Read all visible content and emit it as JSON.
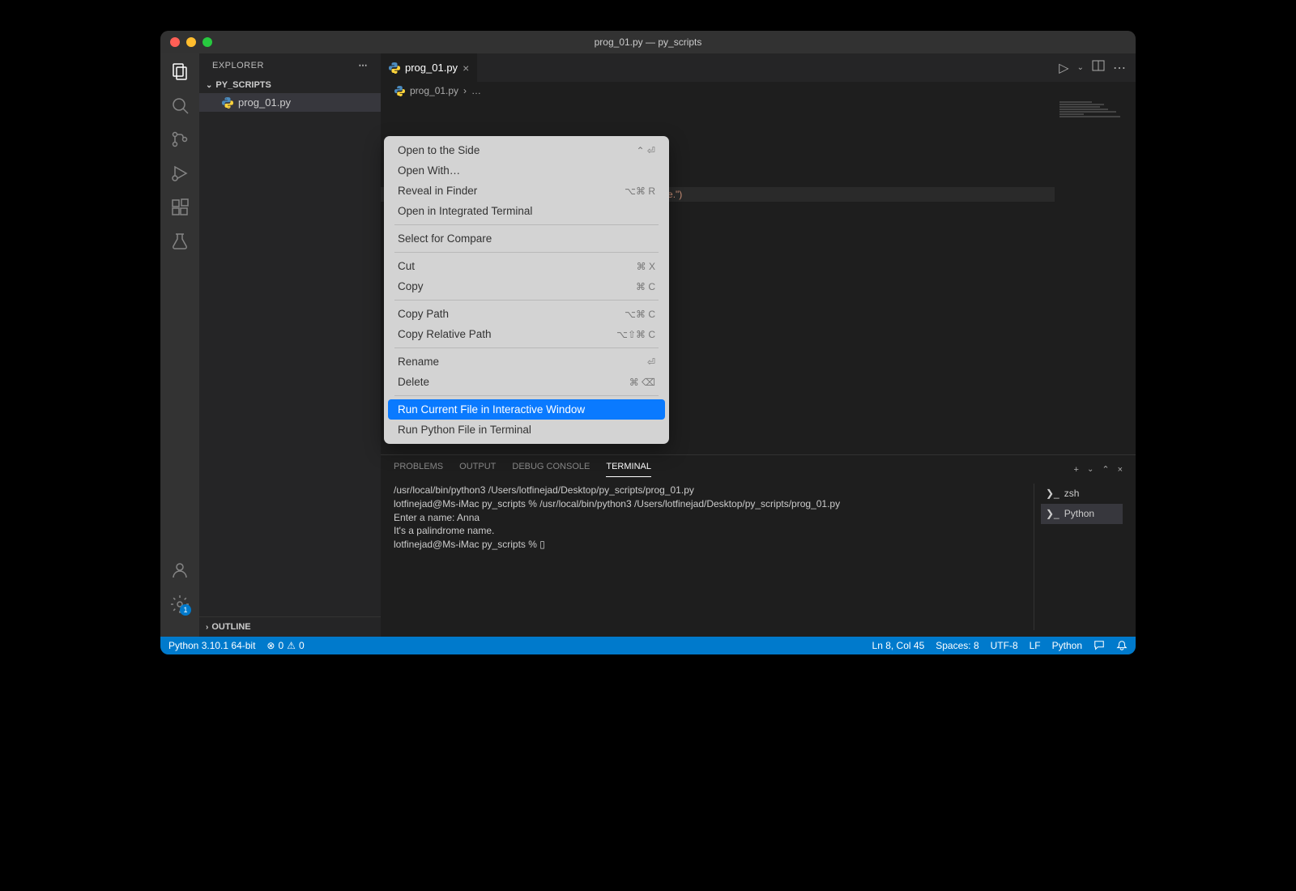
{
  "window": {
    "title": "prog_01.py — py_scripts"
  },
  "sidebar": {
    "header": "EXPLORER",
    "folder": "PY_SCRIPTS",
    "file": "prog_01.py",
    "outline": "OUTLINE"
  },
  "tab": {
    "filename": "prog_01.py"
  },
  "breadcrumb": {
    "file": "prog_01.py",
    "sep": "›",
    "more": "…"
  },
  "code": {
    "visible_fragments": [
      " name.\")",
      "rome name.\")"
    ]
  },
  "context_menu": {
    "items": [
      {
        "label": "Open to the Side",
        "shortcut": "⌃  ⏎"
      },
      {
        "label": "Open With…",
        "shortcut": ""
      },
      {
        "label": "Reveal in Finder",
        "shortcut": "⌥⌘ R"
      },
      {
        "label": "Open in Integrated Terminal",
        "shortcut": ""
      }
    ],
    "group2": [
      {
        "label": "Select for Compare",
        "shortcut": ""
      }
    ],
    "group3": [
      {
        "label": "Cut",
        "shortcut": "⌘ X"
      },
      {
        "label": "Copy",
        "shortcut": "⌘ C"
      }
    ],
    "group4": [
      {
        "label": "Copy Path",
        "shortcut": "⌥⌘ C"
      },
      {
        "label": "Copy Relative Path",
        "shortcut": "⌥⇧⌘ C"
      }
    ],
    "group5": [
      {
        "label": "Rename",
        "shortcut": "⏎"
      },
      {
        "label": "Delete",
        "shortcut": "⌘ ⌫"
      }
    ],
    "group6": [
      {
        "label": "Run Current File in Interactive Window",
        "shortcut": "",
        "highlighted": true
      },
      {
        "label": "Run Python File in Terminal",
        "shortcut": ""
      }
    ]
  },
  "panel": {
    "tabs": [
      "PROBLEMS",
      "OUTPUT",
      "DEBUG CONSOLE",
      "TERMINAL"
    ],
    "active": "TERMINAL",
    "terminal_lines": [
      "/usr/local/bin/python3 /Users/lotfinejad/Desktop/py_scripts/prog_01.py",
      "lotfinejad@Ms-iMac py_scripts % /usr/local/bin/python3 /Users/lotfinejad/Desktop/py_scripts/prog_01.py",
      "Enter a name: Anna",
      "It's a palindrome name.",
      "lotfinejad@Ms-iMac py_scripts % ▯"
    ],
    "sessions": [
      {
        "name": "zsh",
        "active": false
      },
      {
        "name": "Python",
        "active": true
      }
    ]
  },
  "status": {
    "interpreter": "Python 3.10.1 64-bit",
    "errors": "0",
    "warnings": "0",
    "cursor": "Ln 8, Col 45",
    "spaces": "Spaces: 8",
    "encoding": "UTF-8",
    "eol": "LF",
    "language": "Python"
  }
}
